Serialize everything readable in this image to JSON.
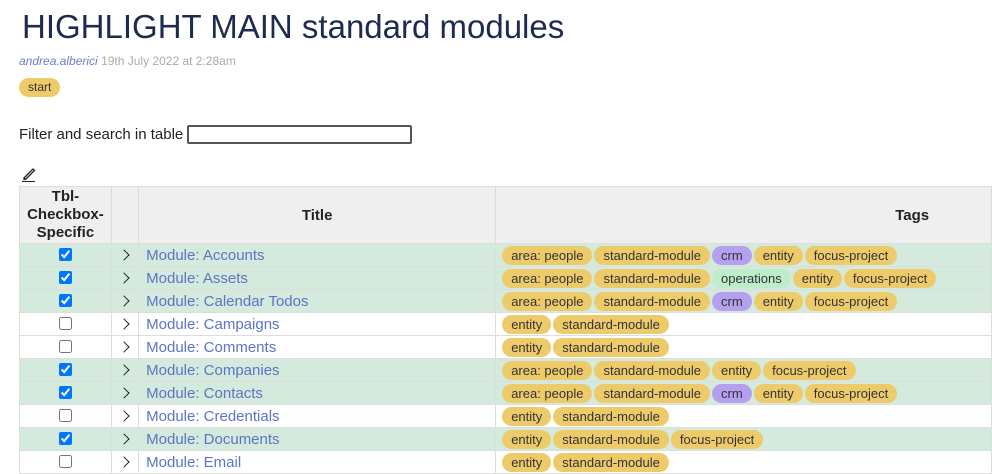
{
  "page": {
    "title": "HIGHLIGHT MAIN standard modules",
    "author": "andrea.alberici",
    "date": "19th July 2022 at 2:28am",
    "start_tag": "start"
  },
  "filter": {
    "label": "Filter and search in table",
    "value": ""
  },
  "icons": {
    "edit": "pencil-edit-icon",
    "expand": "chevron-right-icon"
  },
  "colors": {
    "tag_default": "#eecb6a",
    "tag_crm": "#b4a0ef",
    "tag_operations": "#bdeec9",
    "row_selected": "#d4eadc"
  },
  "table": {
    "headers": [
      "Tbl-Checkbox-Specific",
      "",
      "Title",
      "Tags"
    ],
    "rows": [
      {
        "checked": true,
        "title": "Module: Accounts",
        "tags": [
          "area: people",
          "standard-module",
          "crm",
          "entity",
          "focus-project"
        ]
      },
      {
        "checked": true,
        "title": "Module: Assets",
        "tags": [
          "area: people",
          "standard-module",
          "operations",
          "entity",
          "focus-project"
        ]
      },
      {
        "checked": true,
        "title": "Module: Calendar Todos",
        "tags": [
          "area: people",
          "standard-module",
          "crm",
          "entity",
          "focus-project"
        ]
      },
      {
        "checked": false,
        "title": "Module: Campaigns",
        "tags": [
          "entity",
          "standard-module"
        ]
      },
      {
        "checked": false,
        "title": "Module: Comments",
        "tags": [
          "entity",
          "standard-module"
        ]
      },
      {
        "checked": true,
        "title": "Module: Companies",
        "tags": [
          "area: people",
          "standard-module",
          "entity",
          "focus-project"
        ]
      },
      {
        "checked": true,
        "title": "Module: Contacts",
        "tags": [
          "area: people",
          "standard-module",
          "crm",
          "entity",
          "focus-project"
        ]
      },
      {
        "checked": false,
        "title": "Module: Credentials",
        "tags": [
          "entity",
          "standard-module"
        ]
      },
      {
        "checked": true,
        "title": "Module: Documents",
        "tags": [
          "entity",
          "standard-module",
          "focus-project"
        ]
      },
      {
        "checked": false,
        "title": "Module: Email",
        "tags": [
          "entity",
          "standard-module"
        ]
      }
    ]
  }
}
